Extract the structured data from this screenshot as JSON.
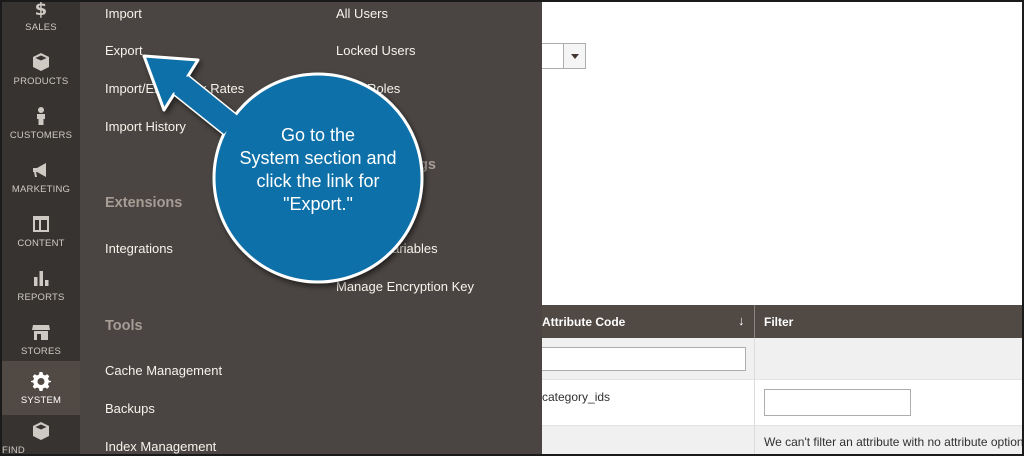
{
  "sidebar": {
    "items": [
      {
        "label": "SALES",
        "icon": "dollar-icon",
        "active": false
      },
      {
        "label": "PRODUCTS",
        "icon": "cube-icon",
        "active": false
      },
      {
        "label": "CUSTOMERS",
        "icon": "person-icon",
        "active": false
      },
      {
        "label": "MARKETING",
        "icon": "megaphone-icon",
        "active": false
      },
      {
        "label": "CONTENT",
        "icon": "layout-icon",
        "active": false
      },
      {
        "label": "REPORTS",
        "icon": "bar-chart-icon",
        "active": false
      },
      {
        "label": "STORES",
        "icon": "storefront-icon",
        "active": false
      },
      {
        "label": "SYSTEM",
        "icon": "gear-icon",
        "active": true
      },
      {
        "label": "FIND PARTNERS",
        "icon": "box-icon",
        "active": false
      }
    ]
  },
  "flyout": {
    "col1": {
      "data_transfer": [
        "Import",
        "Export",
        "Import/Export Tax Rates",
        "Import History"
      ],
      "extensions_title": "Extensions",
      "extensions": [
        "Integrations"
      ],
      "tools_title": "Tools",
      "tools": [
        "Cache Management",
        "Backups",
        "Index Management"
      ]
    },
    "col2": {
      "permissions": [
        "All Users",
        "Locked Users",
        "User Roles"
      ],
      "other_settings_title": "Other Settings",
      "other": [
        "Custom Variables",
        "Manage Encryption Key"
      ]
    }
  },
  "grid": {
    "code_header": "Attribute Code",
    "sort_glyph": "↓",
    "filter_header": "Filter",
    "row_code": "category_ids",
    "note": "We can't filter an attribute with no attribute options."
  },
  "callout": {
    "lines": [
      "Go to the",
      "System section and",
      "click the link for",
      "\"Export.\""
    ],
    "color": "#0f6fa8"
  }
}
